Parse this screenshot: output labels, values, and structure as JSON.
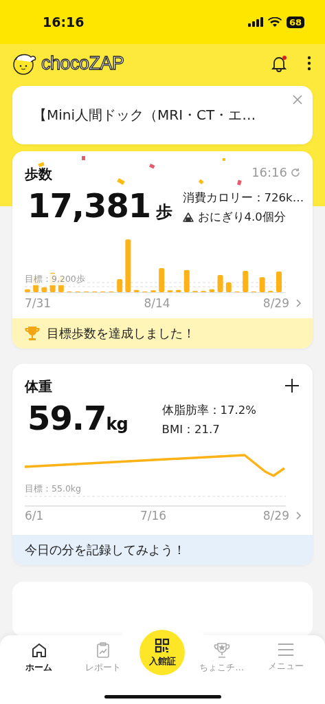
{
  "status_bar": {
    "time": "16:16",
    "battery": "68"
  },
  "header": {
    "logo": "chocoZAP",
    "notification_unread": true
  },
  "banner": {
    "text": "【Mini人間ドック（MRI・CT・エ…"
  },
  "steps_card": {
    "title": "歩数",
    "updated": "16:16",
    "value": "17,381",
    "unit": "歩",
    "calories": "消費カロリー：726k…",
    "equivalent": "おにぎり4.0個分",
    "goal_label": "目標：9,200歩",
    "x_labels": [
      "7/31",
      "8/14",
      "8/29"
    ],
    "achievement": "目標歩数を達成しました！"
  },
  "weight_card": {
    "title": "体重",
    "value": "59.7",
    "unit": "kg",
    "body_fat": "体脂肪率：17.2%",
    "bmi": "BMI：21.7",
    "goal_label": "目標：55.0kg",
    "x_labels": [
      "6/1",
      "7/16",
      "8/29"
    ],
    "prompt": "今日の分を記録してみよう！"
  },
  "nav": {
    "items": [
      {
        "label": "ホーム",
        "kind": "tab",
        "selected": true
      },
      {
        "label": "レポート",
        "kind": "tab",
        "selected": false
      },
      {
        "label": "入館証",
        "kind": "center",
        "selected": false
      },
      {
        "label": "ちょこチ…",
        "kind": "tab",
        "selected": false
      },
      {
        "label": "メニュー",
        "kind": "tab",
        "selected": false
      }
    ]
  }
}
